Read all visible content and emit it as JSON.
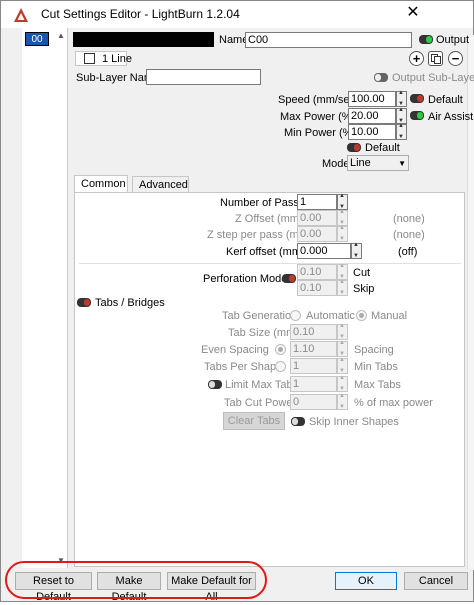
{
  "window": {
    "title": "Cut Settings Editor - LightBurn 1.2.04",
    "close": "✕"
  },
  "layer_list": {
    "selected": "00"
  },
  "header": {
    "name_label": "Name",
    "name_value": "C00",
    "output_label": "Output",
    "line_tab": "1 Line",
    "sublayer_label": "Sub-Layer Name",
    "output_sublayer_label": "Output Sub-Layer"
  },
  "power": {
    "speed_label": "Speed (mm/sec)",
    "speed_value": "100.00",
    "default_label": "Default",
    "maxpower_label": "Max Power (%)",
    "maxpower_value": "20.00",
    "air_assist_label": "Air Assist",
    "minpower_label": "Min Power (%)",
    "minpower_value": "10.00",
    "default2_label": "Default",
    "mode_label": "Mode",
    "mode_value": "Line"
  },
  "tabs": {
    "common": "Common",
    "advanced": "Advanced"
  },
  "common": {
    "passes_label": "Number of Passes",
    "passes_value": "1",
    "zoffset_label": "Z Offset (mm)",
    "zoffset_value": "0.00",
    "zoffset_note": "(none)",
    "zstep_label": "Z step per pass (mm)",
    "zstep_value": "0.00",
    "zstep_note": "(none)",
    "kerf_label": "Kerf offset (mm)",
    "kerf_value": "0.000",
    "kerf_note": "(off)",
    "perf_label": "Perforation Mode",
    "perf_cut_value": "0.10",
    "perf_cut_label": "Cut",
    "perf_skip_value": "0.10",
    "perf_skip_label": "Skip"
  },
  "tabs_bridges": {
    "section_label": "Tabs / Bridges",
    "generation_label": "Tab Generation",
    "automatic": "Automatic",
    "manual": "Manual",
    "size_label": "Tab Size (mm)",
    "size_value": "0.10",
    "even_label": "Even Spacing",
    "even_value": "1.10",
    "spacing_label": "Spacing",
    "per_shape_label": "Tabs Per Shape",
    "per_shape_value": "1",
    "min_tabs_label": "Min Tabs",
    "limit_label": "Limit Max Tabs",
    "limit_value": "1",
    "max_tabs_label": "Max Tabs",
    "cut_power_label": "Tab Cut Power",
    "cut_power_value": "0",
    "cut_power_unit": "% of max power",
    "clear_tabs": "Clear Tabs",
    "skip_inner": "Skip Inner Shapes"
  },
  "footer": {
    "reset": "Reset to Default",
    "make_default": "Make Default",
    "make_default_all": "Make Default for All",
    "ok": "OK",
    "cancel": "Cancel"
  },
  "colors": {
    "accent": "#1a56b0",
    "highlight_ring": "#e01919",
    "toggle_on": "#2ecc40",
    "toggle_red": "#c0392b"
  }
}
